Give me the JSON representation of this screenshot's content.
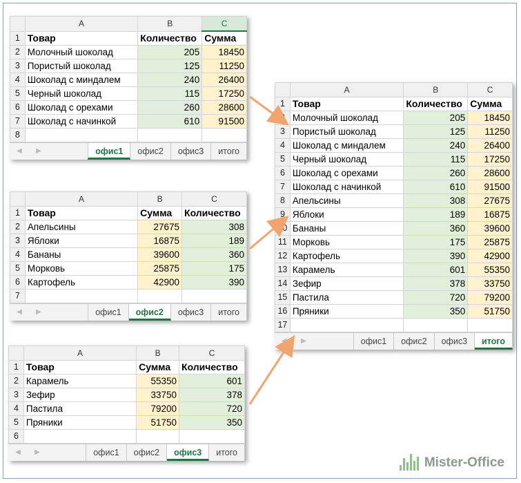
{
  "colors": {
    "green_cell": "#e2efda",
    "yellow_cell": "#fff2cc",
    "accent": "#217346",
    "arrow": "#f2a46e"
  },
  "tabs": [
    "офис1",
    "офис2",
    "офис3",
    "итого"
  ],
  "sheet1": {
    "cols": [
      "A",
      "B",
      "C"
    ],
    "rownums": [
      "1",
      "2",
      "3",
      "4",
      "5",
      "6",
      "7",
      "8"
    ],
    "header": [
      "Товар",
      "Количество",
      "Сумма"
    ],
    "rows": [
      [
        "Молочный шоколад",
        "205",
        "18450"
      ],
      [
        "Пористый шоколад",
        "125",
        "11250"
      ],
      [
        "Шоколад с миндалем",
        "240",
        "26400"
      ],
      [
        "Черный шоколад",
        "115",
        "17250"
      ],
      [
        "Шоколад с орехами",
        "260",
        "28600"
      ],
      [
        "Шоколад с начинкой",
        "610",
        "91500"
      ]
    ]
  },
  "sheet2": {
    "cols": [
      "A",
      "B",
      "C"
    ],
    "rownums": [
      "1",
      "2",
      "3",
      "4",
      "5",
      "6",
      "7"
    ],
    "header": [
      "Товар",
      "Сумма",
      "Количество"
    ],
    "rows": [
      [
        "Апельсины",
        "27675",
        "308"
      ],
      [
        "Яблоки",
        "16875",
        "189"
      ],
      [
        "Бананы",
        "39600",
        "360"
      ],
      [
        "Морковь",
        "25875",
        "175"
      ],
      [
        "Картофель",
        "42900",
        "390"
      ]
    ]
  },
  "sheet3": {
    "cols": [
      "A",
      "B",
      "C"
    ],
    "rownums": [
      "1",
      "2",
      "3",
      "4",
      "5",
      "6"
    ],
    "header": [
      "Товар",
      "Сумма",
      "Количество"
    ],
    "rows": [
      [
        "Карамель",
        "55350",
        "601"
      ],
      [
        "Зефир",
        "33750",
        "378"
      ],
      [
        "Пастила",
        "79200",
        "720"
      ],
      [
        "Пряники",
        "51750",
        "350"
      ]
    ]
  },
  "sheet4": {
    "cols": [
      "A",
      "B",
      "C"
    ],
    "rownums": [
      "1",
      "2",
      "3",
      "4",
      "5",
      "6",
      "7",
      "8",
      "9",
      "10",
      "11",
      "12",
      "13",
      "14",
      "15",
      "16",
      "17"
    ],
    "header": [
      "Товар",
      "Количество",
      "Сумма"
    ],
    "rows": [
      [
        "Молочный шоколад",
        "205",
        "18450"
      ],
      [
        "Пористый шоколад",
        "125",
        "11250"
      ],
      [
        "Шоколад с миндалем",
        "240",
        "26400"
      ],
      [
        "Черный шоколад",
        "115",
        "17250"
      ],
      [
        "Шоколад с орехами",
        "260",
        "28600"
      ],
      [
        "Шоколад с начинкой",
        "610",
        "91500"
      ],
      [
        "Апельсины",
        "308",
        "27675"
      ],
      [
        "Яблоки",
        "189",
        "16875"
      ],
      [
        "Бананы",
        "360",
        "39600"
      ],
      [
        "Морковь",
        "175",
        "25875"
      ],
      [
        "Картофель",
        "390",
        "42900"
      ],
      [
        "Карамель",
        "601",
        "55350"
      ],
      [
        "Зефир",
        "378",
        "33750"
      ],
      [
        "Пастила",
        "720",
        "79200"
      ],
      [
        "Пряники",
        "350",
        "51750"
      ]
    ]
  },
  "logo": {
    "text": "Mister-Office"
  }
}
